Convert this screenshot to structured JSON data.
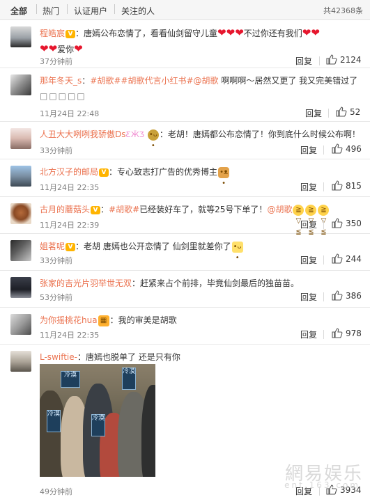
{
  "tabs": {
    "items": [
      "全部",
      "热门",
      "认证用户",
      "关注的人"
    ],
    "total": "共42368条"
  },
  "ui": {
    "reply_label": "回复",
    "heart": "❤"
  },
  "comments": [
    {
      "user": "程皓宸",
      "content": "唐嫣公布恋情了，看看仙剑留守儿童",
      "content_tail": "不过你还有我们",
      "content_end": "爱你",
      "time": "37分钟前",
      "likes": "2124"
    },
    {
      "user": "那年冬天_s",
      "hashtags": "#胡歌##胡歌代言小红书#@胡歌",
      "content": " 啊啊啊～居然又更了 我又完美错过了",
      "boxes": "□□□□□",
      "time": "11月24日 22:48",
      "likes": "52"
    },
    {
      "user": "人丑大大咧咧我骄傲Ds",
      "content": "老胡！唐嫣都公布恋情了！你到底什么时候公布啊！",
      "time": "33分钟前",
      "likes": "496"
    },
    {
      "user": "北方汉子的邮局",
      "content": "专心致志打广告的优秀博主",
      "time": "11月24日 22:35",
      "likes": "815"
    },
    {
      "user": "古月的蘑菇头",
      "hashtags": "#胡歌#",
      "content": "已经装好车了，就等25号下单了！",
      "mention": "@胡歌",
      "time": "11月24日 22:39",
      "likes": "350"
    },
    {
      "user": "姐茗呢",
      "content": "老胡 唐嫣也公开恋情了 仙剑里就差你了",
      "time": "33分钟前",
      "likes": "244"
    },
    {
      "user": "张家的吉光片羽举世无双",
      "content": "赶紧来占个前排，毕竟仙剑最后的独苗苗。",
      "time": "53分钟前",
      "likes": "386"
    },
    {
      "user": "为你摇桃花hua",
      "content": "我的审美是胡歌",
      "time": "11月24日 22:35",
      "likes": "978"
    },
    {
      "user": "L-swiftie-",
      "content": "唐嫣也脱单了    还是只有你",
      "time": "49分钟前",
      "likes": "3934",
      "picture_signs": [
        "冷漠",
        "冷漠",
        "冷漠",
        "冷漠"
      ]
    }
  ],
  "watermark": {
    "logo": "網易娱乐",
    "url": "ent.163.com"
  },
  "colors": {
    "username": "#eb7350",
    "heart": "#e6162d",
    "meta": "#808080"
  }
}
